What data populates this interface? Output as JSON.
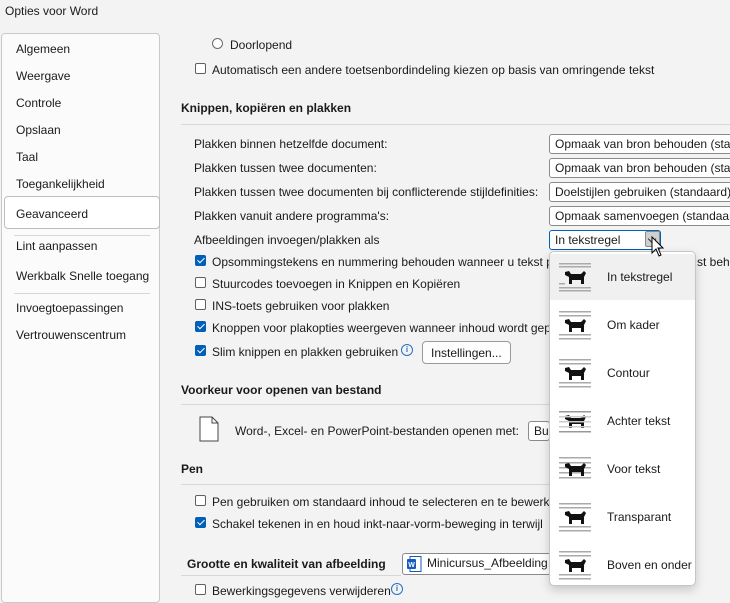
{
  "window": {
    "title": "Opties voor Word"
  },
  "nav": {
    "items": [
      "Algemeen",
      "Weergave",
      "Controle",
      "Opslaan",
      "Taal",
      "Toegankelijkheid",
      "Geavanceerd",
      "Lint aanpassen",
      "Werkbalk Snelle toegang",
      "Invoegtoepassingen",
      "Vertrouwenscentrum"
    ],
    "selected": "Geavanceerd"
  },
  "top": {
    "radio_label": "Doorlopend",
    "auto_keyboard_label": "Automatisch een andere toetsenbordindeling kiezen op basis van omringende tekst",
    "auto_keyboard_checked": false
  },
  "cut_copy_paste": {
    "heading": "Knippen, kopiëren en plakken",
    "rows": [
      {
        "label": "Plakken binnen hetzelfde document:",
        "value": "Opmaak van bron behouden (sta"
      },
      {
        "label": "Plakken tussen twee documenten:",
        "value": "Opmaak van bron behouden (sta"
      },
      {
        "label": "Plakken tussen twee documenten bij conflicterende stijldefinities:",
        "value": "Doelstijlen gebruiken (standaard)"
      },
      {
        "label": "Plakken vanuit andere programma's:",
        "value": "Opmaak samenvoegen (standaar"
      },
      {
        "label": "Afbeeldingen invoegen/plakken als",
        "value": "In tekstregel"
      }
    ],
    "checkboxes": [
      {
        "label": "Opsommingstekens en nummering behouden wanneer u tekst p",
        "tail": "st behc",
        "checked": true
      },
      {
        "label": "Stuurcodes toevoegen in Knippen en Kopiëren",
        "checked": false
      },
      {
        "label": "INS-toets gebruiken voor plakken",
        "checked": false
      },
      {
        "label": "Knoppen voor plakopties weergeven wanneer inhoud wordt gep",
        "checked": true
      },
      {
        "label": "Slim knippen en plakken gebruiken",
        "checked": true
      }
    ],
    "settings_button": "Instellingen..."
  },
  "open_pref": {
    "heading": "Voorkeur voor openen van bestand",
    "label": "Word-, Excel- en PowerPoint-bestanden openen met:",
    "value": "Bu"
  },
  "pen": {
    "heading": "Pen",
    "checkboxes": [
      {
        "label": "Pen gebruiken om standaard inhoud te selecteren en te bewerke",
        "checked": false
      },
      {
        "label": "Schakel tekenen in en houd inkt-naar-vorm-beweging in terwijl",
        "checked": true
      }
    ]
  },
  "image_quality": {
    "heading": "Grootte en kwaliteit van afbeelding",
    "document": "Minicursus_Afbeelding",
    "partial_label": "Bewerkingsgegevens verwijderen"
  },
  "wrap_menu": {
    "items": [
      "In tekstregel",
      "Om kader",
      "Contour",
      "Achter tekst",
      "Voor tekst",
      "Transparant",
      "Boven en onder"
    ],
    "highlighted": "In tekstregel"
  },
  "colors": {
    "accent": "#005fb8",
    "info": "#2b6ec8"
  }
}
